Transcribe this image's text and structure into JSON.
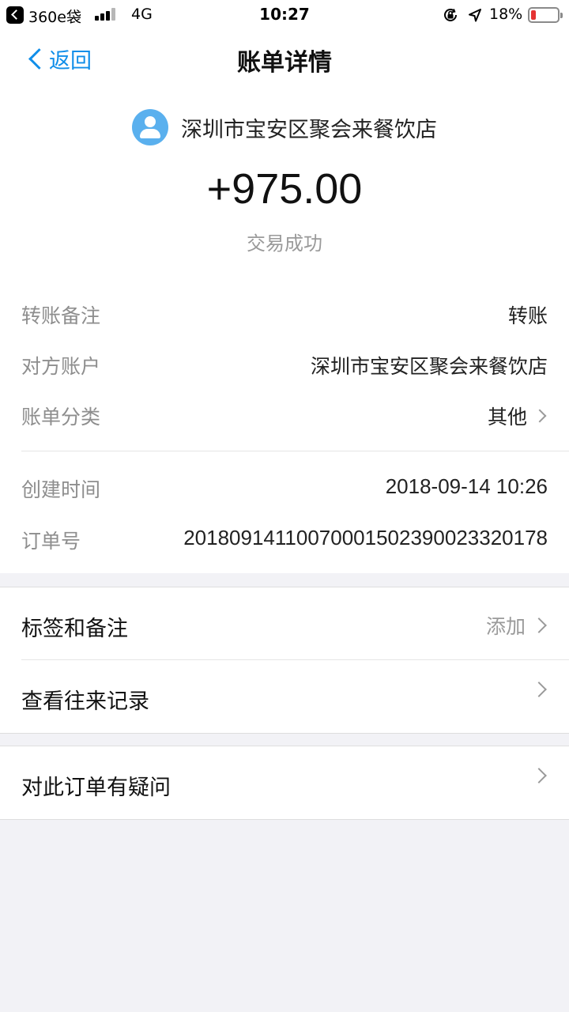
{
  "status_bar": {
    "carrier": "360e袋",
    "network": "4G",
    "time": "10:27",
    "battery_percent": "18%",
    "battery_level": 0.18,
    "battery_color": "#e53333"
  },
  "nav": {
    "back_label": "返回",
    "title": "账单详情",
    "accent_color": "#108ee9"
  },
  "summary": {
    "merchant_name": "深圳市宝安区聚会来餐饮店",
    "amount": "+975.00",
    "status": "交易成功",
    "avatar_icon": "user-avatar-icon"
  },
  "details": [
    {
      "label": "转账备注",
      "value": "转账"
    },
    {
      "label": "对方账户",
      "value": "深圳市宝安区聚会来餐饮店"
    },
    {
      "label": "账单分类",
      "value": "其他"
    },
    {
      "label": "创建时间",
      "value": "2018-09-14 10:26"
    },
    {
      "label": "订单号",
      "value": "20180914110070001502390023320178"
    }
  ],
  "actions": {
    "tags_notes": {
      "label": "标签和备注",
      "hint": "添加"
    },
    "history": {
      "label": "查看往来记录"
    },
    "question": {
      "label": "对此订单有疑问"
    }
  }
}
